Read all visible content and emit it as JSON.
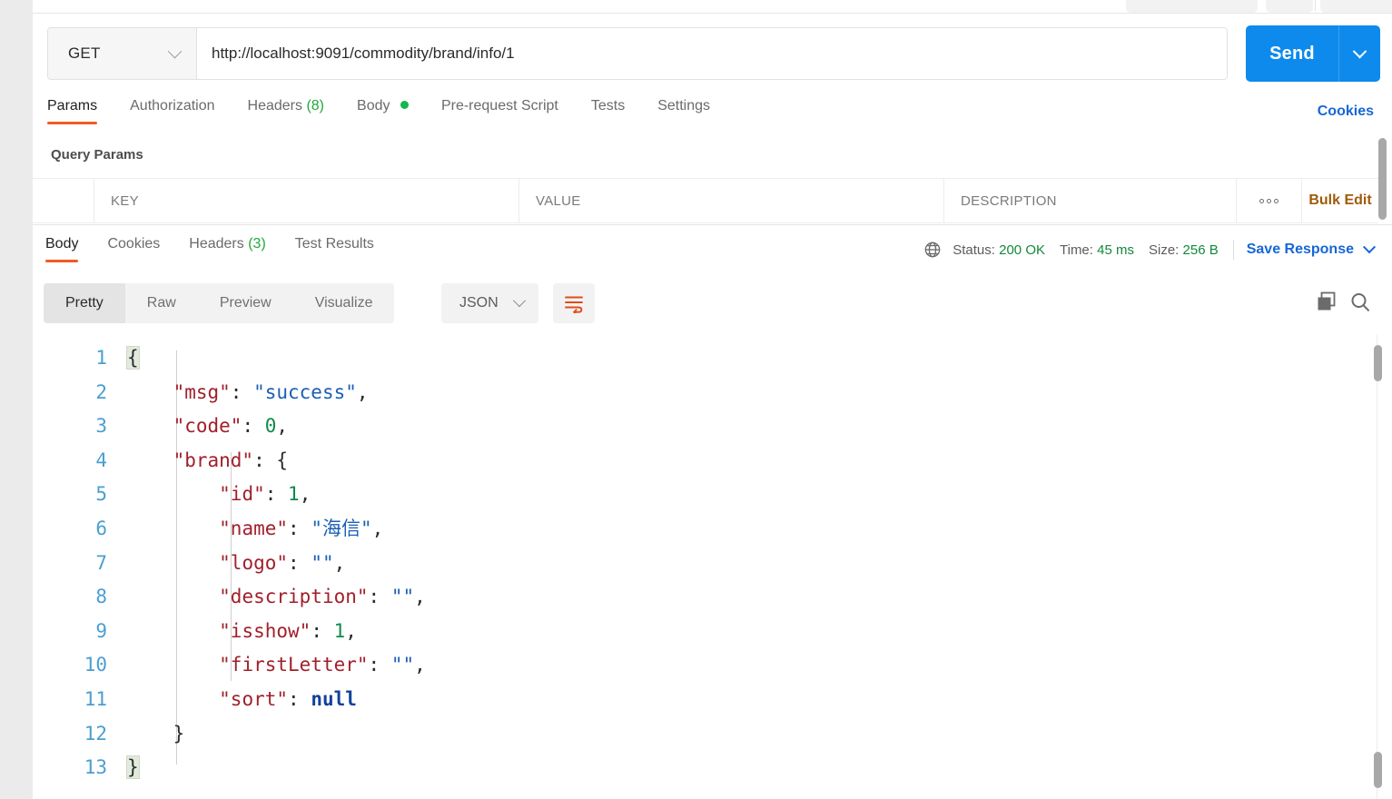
{
  "request": {
    "method": "GET",
    "method_icon": "chevron-down-icon",
    "url": "http://localhost:9091/commodity/brand/info/1",
    "send_label": "Send",
    "send_caret_icon": "chevron-down-icon",
    "cookies_link": "Cookies",
    "tabs": [
      {
        "label": "Params",
        "count": "",
        "active": true,
        "dot": false
      },
      {
        "label": "Authorization",
        "count": "",
        "active": false,
        "dot": false
      },
      {
        "label": "Headers",
        "count": "(8)",
        "active": false,
        "dot": false
      },
      {
        "label": "Body",
        "count": "",
        "active": false,
        "dot": true
      },
      {
        "label": "Pre-request Script",
        "count": "",
        "active": false,
        "dot": false
      },
      {
        "label": "Tests",
        "count": "",
        "active": false,
        "dot": false
      },
      {
        "label": "Settings",
        "count": "",
        "active": false,
        "dot": false
      }
    ],
    "query_params": {
      "title": "Query Params",
      "columns": [
        "KEY",
        "VALUE",
        "DESCRIPTION"
      ],
      "rows": [],
      "more_icon": "three-dots-icon",
      "bulk_edit_label": "Bulk Edit"
    }
  },
  "response": {
    "tabs": [
      {
        "label": "Body",
        "count": "",
        "active": true
      },
      {
        "label": "Cookies",
        "count": "",
        "active": false
      },
      {
        "label": "Headers",
        "count": "(3)",
        "active": false
      },
      {
        "label": "Test Results",
        "count": "",
        "active": false
      }
    ],
    "network_icon": "globe-icon",
    "status_label": "Status:",
    "status_value": "200 OK",
    "time_label": "Time:",
    "time_value": "45 ms",
    "size_label": "Size:",
    "size_value": "256 B",
    "save_response_label": "Save Response",
    "save_response_caret_icon": "chevron-down-icon",
    "format_tabs": [
      {
        "label": "Pretty",
        "active": true
      },
      {
        "label": "Raw",
        "active": false
      },
      {
        "label": "Preview",
        "active": false
      },
      {
        "label": "Visualize",
        "active": false
      }
    ],
    "language": "JSON",
    "language_caret_icon": "chevron-down-icon",
    "wrap_icon": "word-wrap-icon",
    "copy_icon": "copy-icon",
    "search_icon": "search-icon",
    "body_lines": [
      {
        "no": "1",
        "html": "<span class=\"p brace-hl\">{</span>"
      },
      {
        "no": "2",
        "html": "    <span class=\"k\">\"msg\"</span><span class=\"p\">: </span><span class=\"s\">\"success\"</span><span class=\"p\">,</span>"
      },
      {
        "no": "3",
        "html": "    <span class=\"k\">\"code\"</span><span class=\"p\">: </span><span class=\"n\">0</span><span class=\"p\">,</span>"
      },
      {
        "no": "4",
        "html": "    <span class=\"k\">\"brand\"</span><span class=\"p\">: {</span>"
      },
      {
        "no": "5",
        "html": "        <span class=\"k\">\"id\"</span><span class=\"p\">: </span><span class=\"n\">1</span><span class=\"p\">,</span>"
      },
      {
        "no": "6",
        "html": "        <span class=\"k\">\"name\"</span><span class=\"p\">: </span><span class=\"s\">\"海信\"</span><span class=\"p\">,</span>"
      },
      {
        "no": "7",
        "html": "        <span class=\"k\">\"logo\"</span><span class=\"p\">: </span><span class=\"s\">\"\"</span><span class=\"p\">,</span>"
      },
      {
        "no": "8",
        "html": "        <span class=\"k\">\"description\"</span><span class=\"p\">: </span><span class=\"s\">\"\"</span><span class=\"p\">,</span>"
      },
      {
        "no": "9",
        "html": "        <span class=\"k\">\"isshow\"</span><span class=\"p\">: </span><span class=\"n\">1</span><span class=\"p\">,</span>"
      },
      {
        "no": "10",
        "html": "        <span class=\"k\">\"firstLetter\"</span><span class=\"p\">: </span><span class=\"s\">\"\"</span><span class=\"p\">,</span>"
      },
      {
        "no": "11",
        "html": "        <span class=\"k\">\"sort\"</span><span class=\"p\">: </span><span class=\"nul\">null</span>"
      },
      {
        "no": "12",
        "html": "    <span class=\"p\">}</span>"
      },
      {
        "no": "13",
        "html": "<span class=\"p brace-hl\">}</span>"
      }
    ],
    "body_json": {
      "msg": "success",
      "code": 0,
      "brand": {
        "id": 1,
        "name": "海信",
        "logo": "",
        "description": "",
        "isshow": 1,
        "firstLetter": "",
        "sort": null
      }
    }
  },
  "colors": {
    "accent_orange": "#ef5b25",
    "link_blue": "#1667d6",
    "send_blue": "#0d8aec",
    "success_green": "#12893a",
    "bulk_amber": "#a05a09"
  }
}
